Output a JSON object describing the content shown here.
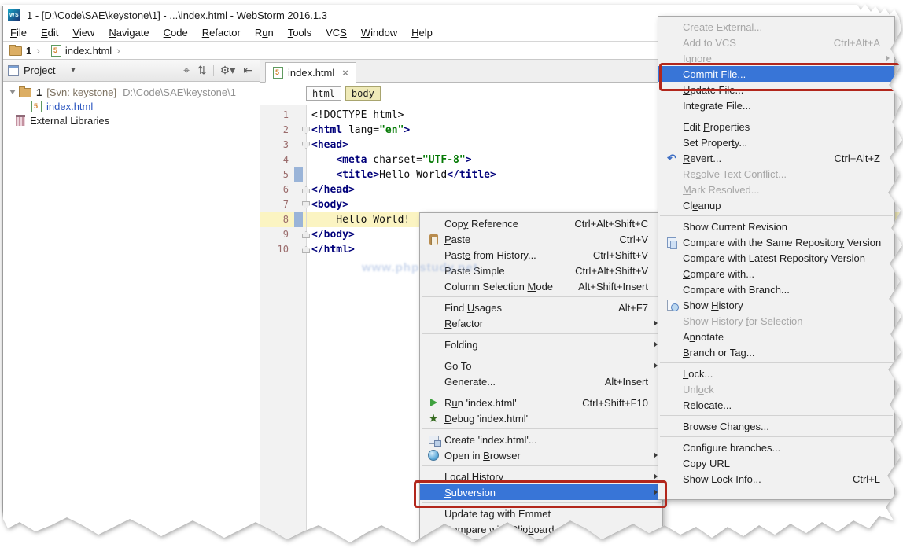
{
  "window": {
    "logo_text": "WS",
    "title": "1 - [D:\\Code\\SAE\\keystone\\1] - ...\\index.html - WebStorm 2016.1.3"
  },
  "menubar": {
    "items": [
      {
        "label": "File",
        "u": 0
      },
      {
        "label": "Edit",
        "u": 0
      },
      {
        "label": "View",
        "u": 0
      },
      {
        "label": "Navigate",
        "u": 0
      },
      {
        "label": "Code",
        "u": 0
      },
      {
        "label": "Refactor",
        "u": 0
      },
      {
        "label": "Run",
        "u": 1
      },
      {
        "label": "Tools",
        "u": 0
      },
      {
        "label": "VCS",
        "u": 2
      },
      {
        "label": "Window",
        "u": 0
      },
      {
        "label": "Help",
        "u": 0
      }
    ]
  },
  "breadcrumb": {
    "chevron": "›",
    "items": [
      {
        "label": "1",
        "icon": "folder-icon"
      },
      {
        "label": "index.html",
        "icon": "html-file-icon"
      }
    ]
  },
  "project": {
    "title": "Project",
    "dropdown_glyph": "▾",
    "toolbar": [
      {
        "name": "locate-icon",
        "glyph": "⌖"
      },
      {
        "name": "collapse-all-icon",
        "glyph": "⇅"
      },
      {
        "name": "separator",
        "glyph": ""
      },
      {
        "name": "settings-gear-icon",
        "glyph": "⚙▾"
      },
      {
        "name": "hide-panel-icon",
        "glyph": "⇤"
      }
    ],
    "tree": [
      {
        "icon": "folder-icon",
        "expander": true,
        "bold": true,
        "label": "1",
        "meta": "[Svn: keystone]",
        "path": "D:\\Code\\SAE\\keystone\\1",
        "indent": 0
      },
      {
        "icon": "html-file-icon",
        "label": "index.html",
        "modified": true,
        "indent": 1
      },
      {
        "icon": "library-icon",
        "label": "External Libraries",
        "indent": 0
      }
    ]
  },
  "editor": {
    "tab": {
      "label": "index.html",
      "close_glyph": "×"
    },
    "crumbs": [
      {
        "label": "html",
        "current": false
      },
      {
        "label": "body",
        "current": true
      }
    ],
    "current_line": 8,
    "changed_lines": [
      5,
      8
    ],
    "fold_starts": [
      2,
      3,
      7
    ],
    "fold_ends": [
      6,
      9,
      10
    ],
    "lines": [
      [
        [
          "p",
          "<!DOCTYPE html>"
        ]
      ],
      [
        [
          "t",
          "<html"
        ],
        [
          "p",
          " lang="
        ],
        [
          "s",
          "\"en\""
        ],
        [
          "t",
          ">"
        ]
      ],
      [
        [
          "t",
          "<head>"
        ]
      ],
      [
        [
          "p",
          "    "
        ],
        [
          "t",
          "<meta"
        ],
        [
          "p",
          " charset="
        ],
        [
          "s",
          "\"UTF-8\""
        ],
        [
          "t",
          ">"
        ]
      ],
      [
        [
          "p",
          "    "
        ],
        [
          "t",
          "<title>"
        ],
        [
          "p",
          "Hello World"
        ],
        [
          "t",
          "</title>"
        ]
      ],
      [
        [
          "t",
          "</head>"
        ]
      ],
      [
        [
          "t",
          "<body>"
        ]
      ],
      [
        [
          "p",
          "    Hello World!"
        ]
      ],
      [
        [
          "t",
          "</body>"
        ]
      ],
      [
        [
          "t",
          "</html>"
        ]
      ]
    ]
  },
  "context_menu": {
    "items": [
      {
        "label": "Copy Reference",
        "u": 3,
        "shortcut": "Ctrl+Alt+Shift+C"
      },
      {
        "label": "Paste",
        "u": 0,
        "shortcut": "Ctrl+V",
        "icon": "paste-icon"
      },
      {
        "label": "Paste from History...",
        "u": 4,
        "shortcut": "Ctrl+Shift+V"
      },
      {
        "label": "Paste Simple",
        "u": -1,
        "shortcut": "Ctrl+Alt+Shift+V"
      },
      {
        "label": "Column Selection Mode",
        "u": 17,
        "shortcut": "Alt+Shift+Insert",
        "sep_after": true
      },
      {
        "label": "Find Usages",
        "u": 5,
        "shortcut": "Alt+F7"
      },
      {
        "label": "Refactor",
        "u": 0,
        "submenu": true,
        "sep_after": true
      },
      {
        "label": "Folding",
        "u": -1,
        "submenu": true,
        "sep_after": true
      },
      {
        "label": "Go To",
        "u": -1,
        "submenu": true
      },
      {
        "label": "Generate...",
        "u": -1,
        "shortcut": "Alt+Insert",
        "sep_after": true
      },
      {
        "label": "Run 'index.html'",
        "u": 1,
        "shortcut": "Ctrl+Shift+F10",
        "icon": "run-icon"
      },
      {
        "label": "Debug 'index.html'",
        "u": 0,
        "icon": "debug-icon",
        "sep_after": true
      },
      {
        "label": "Create 'index.html'...",
        "u": -1,
        "icon": "create-run-config-icon"
      },
      {
        "label": "Open in Browser",
        "u": 8,
        "submenu": true,
        "icon": "browser-icon",
        "sep_after": true
      },
      {
        "label": "Local History",
        "u": -1,
        "submenu": true
      },
      {
        "label": "Subversion",
        "u": 0,
        "submenu": true,
        "selected": true,
        "sep_after": true
      },
      {
        "label": "Update tag with Emmet",
        "u": -1
      },
      {
        "label": "Compare with Clipboard",
        "u": 17
      }
    ]
  },
  "vcs_menu": {
    "items": [
      {
        "label": "Create External...",
        "u": -1,
        "disabled": true
      },
      {
        "label": "Add to VCS",
        "u": -1,
        "shortcut": "Ctrl+Alt+A",
        "disabled": true
      },
      {
        "label": "Ignore",
        "u": -1,
        "disabled": true,
        "submenu": true
      },
      {
        "label": "Commit File...",
        "u": 4,
        "selected": true
      },
      {
        "label": "Update File...",
        "u": 0
      },
      {
        "label": "Integrate File...",
        "u": 4,
        "sep_after": true
      },
      {
        "label": "Edit Properties",
        "u": 5
      },
      {
        "label": "Set Property...",
        "u": 10
      },
      {
        "label": "Revert...",
        "u": 0,
        "shortcut": "Ctrl+Alt+Z",
        "icon": "revert-icon"
      },
      {
        "label": "Resolve Text Conflict...",
        "u": 2,
        "disabled": true
      },
      {
        "label": "Mark Resolved...",
        "u": 0,
        "disabled": true
      },
      {
        "label": "Cleanup",
        "u": 2,
        "sep_after": true
      },
      {
        "label": "Show Current Revision",
        "u": -1
      },
      {
        "label": "Compare with the Same Repository Version",
        "u": 31,
        "icon": "compare-repo-icon"
      },
      {
        "label": "Compare with Latest Repository Version",
        "u": 31
      },
      {
        "label": "Compare with...",
        "u": 0
      },
      {
        "label": "Compare with Branch...",
        "u": -1
      },
      {
        "label": "Show History",
        "u": 5,
        "icon": "history-icon"
      },
      {
        "label": "Show History for Selection",
        "u": 13,
        "disabled": true
      },
      {
        "label": "Annotate",
        "u": 1
      },
      {
        "label": "Branch or Tag...",
        "u": 0,
        "sep_after": true
      },
      {
        "label": "Lock...",
        "u": 0
      },
      {
        "label": "Unlock",
        "u": 3,
        "disabled": true
      },
      {
        "label": "Relocate...",
        "u": -1,
        "sep_after": true
      },
      {
        "label": "Browse Changes...",
        "u": -1,
        "sep_after": true
      },
      {
        "label": "Configure branches...",
        "u": -1
      },
      {
        "label": "Copy URL",
        "u": -1
      },
      {
        "label": "Show Lock Info...",
        "u": -1,
        "shortcut": "Ctrl+L"
      }
    ]
  },
  "watermark": {
    "text": "www.phpstudy.net"
  },
  "colors": {
    "selection_blue": "#3875d7",
    "annotation_red": "#b2271c",
    "menu_bg": "#f1f1f1",
    "tag_navy": "#00007a",
    "string_green": "#067a06",
    "current_line_yellow": "#fbf4c2",
    "change_marker_blue": "#9ab4d8",
    "modified_file_blue": "#2b56c0",
    "body_crumb_yellow": "#efeab8"
  }
}
